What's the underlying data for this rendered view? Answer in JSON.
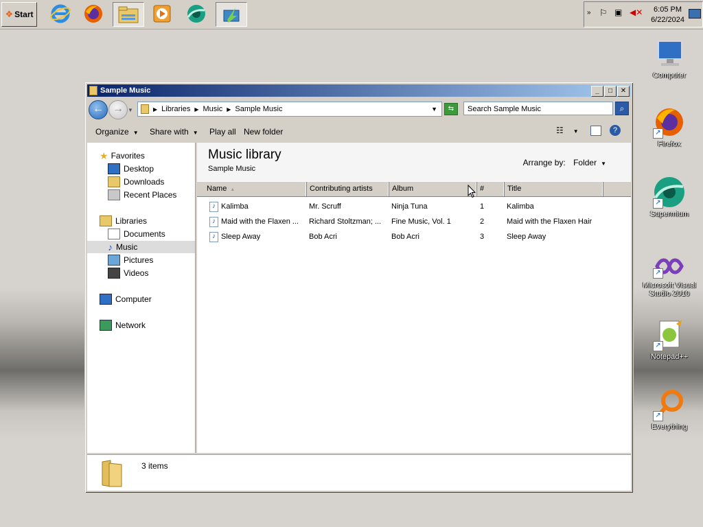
{
  "taskbar": {
    "start_label": "Start",
    "apps": [
      {
        "name": "internet-explorer-icon"
      },
      {
        "name": "firefox-icon"
      },
      {
        "name": "explorer-icon",
        "active": true
      },
      {
        "name": "media-player-icon"
      },
      {
        "name": "supermium-icon"
      },
      {
        "name": "app-icon"
      }
    ],
    "clock_time": "6:05 PM",
    "clock_date": "6/22/2024"
  },
  "desktop_icons": [
    {
      "label": "Computer"
    },
    {
      "label": "Firefox"
    },
    {
      "label": "Supermium"
    },
    {
      "label": "Microsoft Visual Studio 2010"
    },
    {
      "label": "Notepad++"
    },
    {
      "label": "Everything"
    }
  ],
  "window": {
    "title": "Sample Music",
    "breadcrumb": [
      "Libraries",
      "Music",
      "Sample Music"
    ],
    "search_placeholder": "Search Sample Music",
    "toolbar": {
      "organize": "Organize",
      "share_with": "Share with",
      "play_all": "Play all",
      "new_folder": "New folder"
    },
    "nav": {
      "favorites": "Favorites",
      "desktop": "Desktop",
      "downloads": "Downloads",
      "recent_places": "Recent Places",
      "libraries": "Libraries",
      "documents": "Documents",
      "music": "Music",
      "pictures": "Pictures",
      "videos": "Videos",
      "computer": "Computer",
      "network": "Network"
    },
    "library_title": "Music library",
    "library_subtitle": "Sample Music",
    "arrange_by_label": "Arrange by:",
    "arrange_by_value": "Folder",
    "columns": [
      "Name",
      "Contributing artists",
      "Album",
      "#",
      "Title"
    ],
    "rows": [
      {
        "name": "Kalimba",
        "artists": "Mr. Scruff",
        "album": "Ninja Tuna",
        "num": "1",
        "title": "Kalimba"
      },
      {
        "name": "Maid with the Flaxen ...",
        "artists": "Richard Stoltzman; ...",
        "album": "Fine Music, Vol. 1",
        "num": "2",
        "title": "Maid with the Flaxen Hair"
      },
      {
        "name": "Sleep Away",
        "artists": "Bob Acri",
        "album": "Bob Acri",
        "num": "3",
        "title": "Sleep Away"
      }
    ],
    "status_count": "3 items"
  }
}
